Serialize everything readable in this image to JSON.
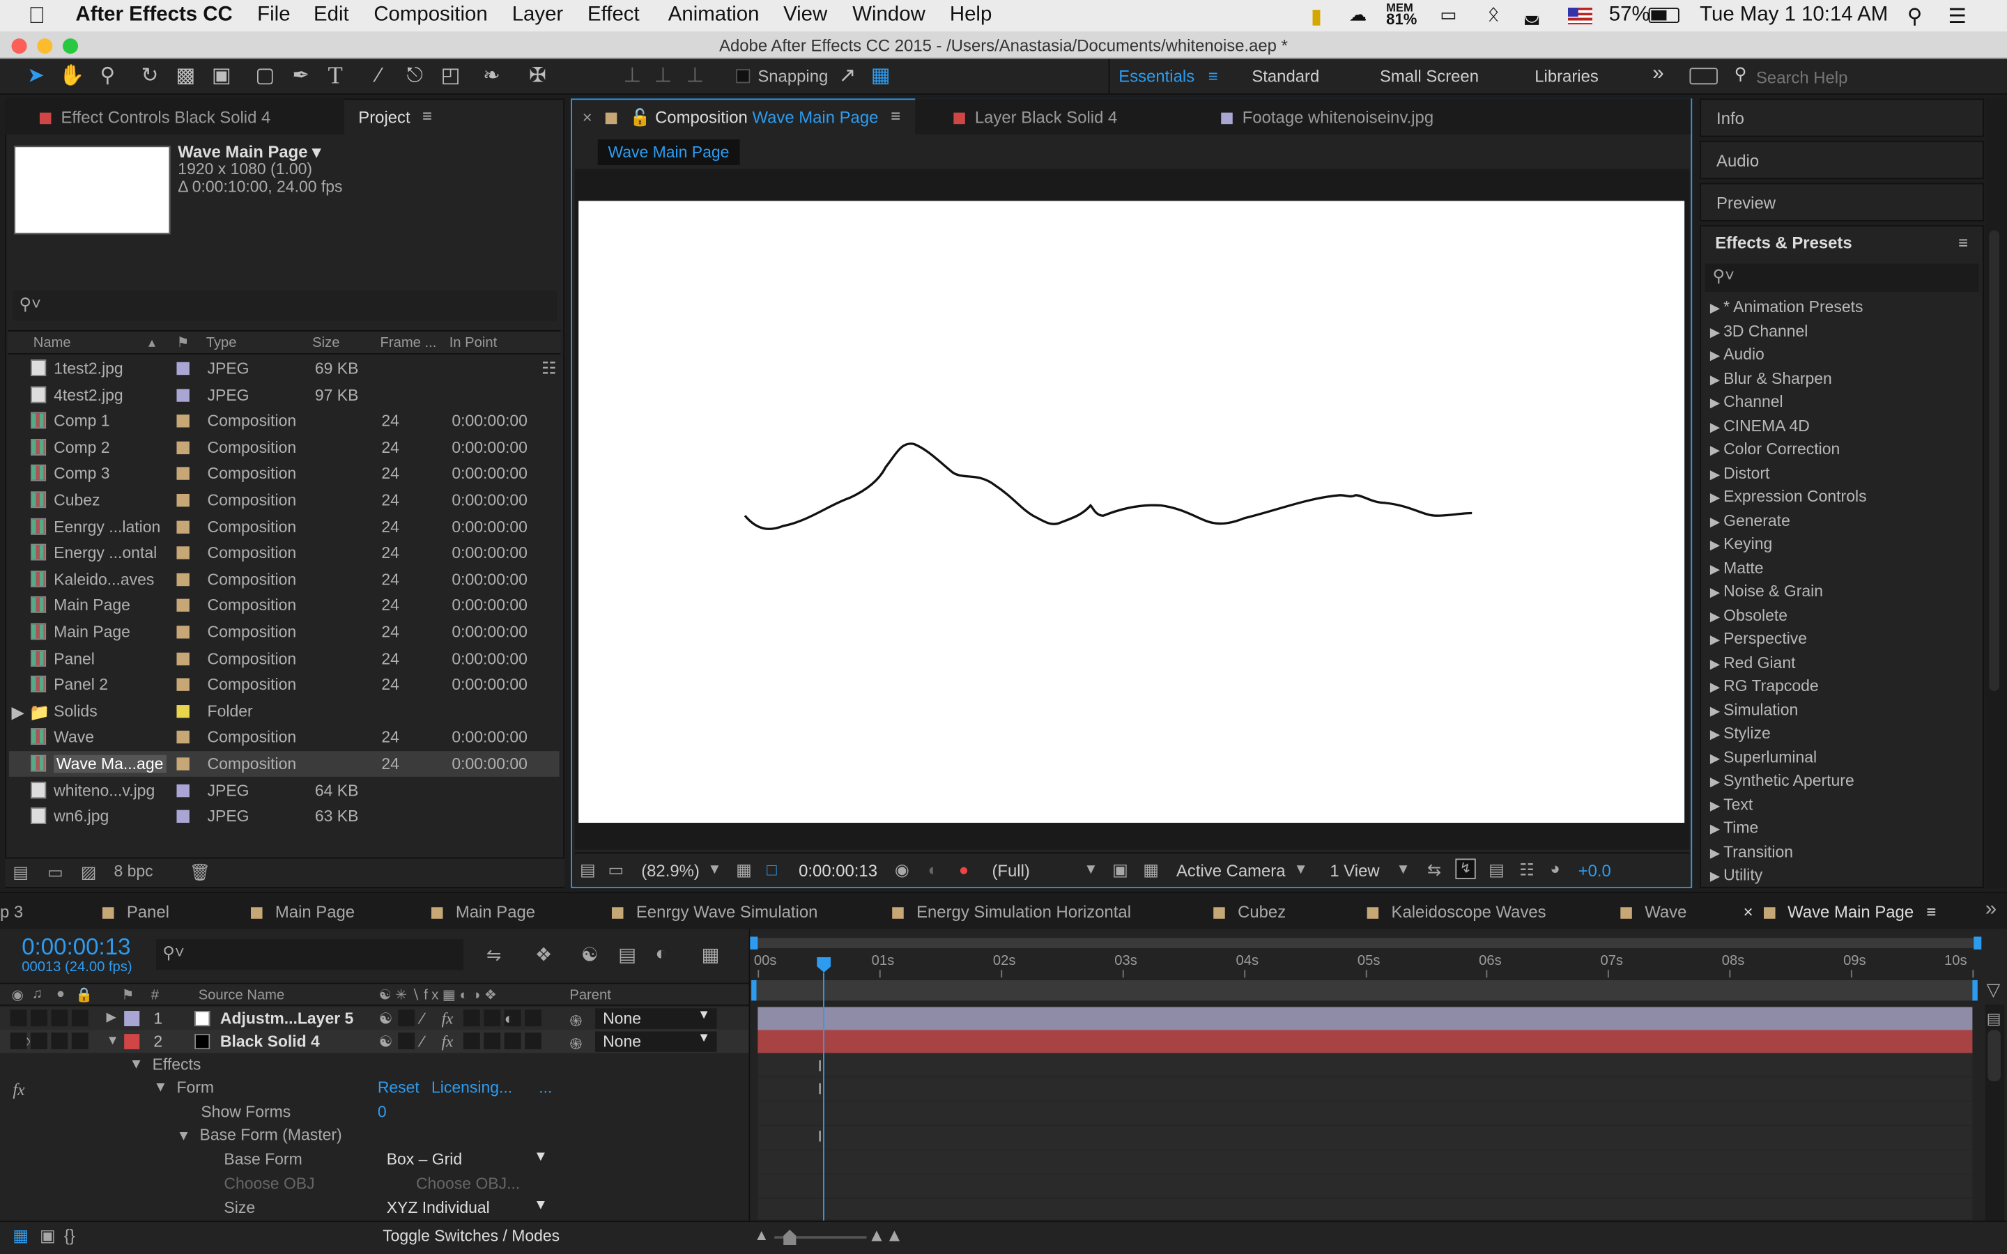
{
  "menubar": {
    "app": "After Effects CC",
    "items": [
      "File",
      "Edit",
      "Composition",
      "Layer",
      "Effect",
      "Animation",
      "View",
      "Window",
      "Help"
    ],
    "mem_label": "MEM",
    "mem_value": "81%",
    "battery": "57%",
    "datetime": "Tue May 1  10:14 AM"
  },
  "window_title": "Adobe After Effects CC 2015 - /Users/Anastasia/Documents/whitenoise.aep *",
  "toolbar": {
    "snapping": "Snapping",
    "workspaces": [
      "Essentials",
      "Standard",
      "Small Screen",
      "Libraries"
    ],
    "search_placeholder": "Search Help"
  },
  "left_panel": {
    "tab_effect_controls": "Effect Controls Black Solid 4",
    "tab_project": "Project",
    "comp_name": "Wave Main Page ▾",
    "comp_res": "1920 x 1080 (1.00)",
    "comp_dur": "Δ 0:00:10:00, 24.00 fps",
    "columns": [
      "Name",
      "Type",
      "Size",
      "Frame ...",
      "In Point"
    ],
    "bpc": "8 bpc",
    "items": [
      {
        "name": "1test2.jpg",
        "type": "JPEG",
        "size": "69 KB",
        "frame": "",
        "inpoint": "",
        "color": "#a9a6d4",
        "kind": "file"
      },
      {
        "name": "4test2.jpg",
        "type": "JPEG",
        "size": "97 KB",
        "frame": "",
        "inpoint": "",
        "color": "#a9a6d4",
        "kind": "file"
      },
      {
        "name": "Comp 1",
        "type": "Composition",
        "size": "",
        "frame": "24",
        "inpoint": "0:00:00:00",
        "color": "#c8a777",
        "kind": "comp"
      },
      {
        "name": "Comp 2",
        "type": "Composition",
        "size": "",
        "frame": "24",
        "inpoint": "0:00:00:00",
        "color": "#c8a777",
        "kind": "comp"
      },
      {
        "name": "Comp 3",
        "type": "Composition",
        "size": "",
        "frame": "24",
        "inpoint": "0:00:00:00",
        "color": "#c8a777",
        "kind": "comp"
      },
      {
        "name": "Cubez",
        "type": "Composition",
        "size": "",
        "frame": "24",
        "inpoint": "0:00:00:00",
        "color": "#c8a777",
        "kind": "comp"
      },
      {
        "name": "Eenrgy ...lation",
        "type": "Composition",
        "size": "",
        "frame": "24",
        "inpoint": "0:00:00:00",
        "color": "#c8a777",
        "kind": "comp"
      },
      {
        "name": "Energy ...ontal",
        "type": "Composition",
        "size": "",
        "frame": "24",
        "inpoint": "0:00:00:00",
        "color": "#c8a777",
        "kind": "comp"
      },
      {
        "name": "Kaleido...aves",
        "type": "Composition",
        "size": "",
        "frame": "24",
        "inpoint": "0:00:00:00",
        "color": "#c8a777",
        "kind": "comp"
      },
      {
        "name": "Main Page",
        "type": "Composition",
        "size": "",
        "frame": "24",
        "inpoint": "0:00:00:00",
        "color": "#c8a777",
        "kind": "comp"
      },
      {
        "name": "Main Page",
        "type": "Composition",
        "size": "",
        "frame": "24",
        "inpoint": "0:00:00:00",
        "color": "#c8a777",
        "kind": "comp"
      },
      {
        "name": "Panel",
        "type": "Composition",
        "size": "",
        "frame": "24",
        "inpoint": "0:00:00:00",
        "color": "#c8a777",
        "kind": "comp"
      },
      {
        "name": "Panel 2",
        "type": "Composition",
        "size": "",
        "frame": "24",
        "inpoint": "0:00:00:00",
        "color": "#c8a777",
        "kind": "comp"
      },
      {
        "name": "Solids",
        "type": "Folder",
        "size": "",
        "frame": "",
        "inpoint": "",
        "color": "#e8d44d",
        "kind": "folder"
      },
      {
        "name": "Wave",
        "type": "Composition",
        "size": "",
        "frame": "24",
        "inpoint": "0:00:00:00",
        "color": "#c8a777",
        "kind": "comp"
      },
      {
        "name": "Wave Ma...age",
        "type": "Composition",
        "size": "",
        "frame": "24",
        "inpoint": "0:00:00:00",
        "color": "#c8a777",
        "kind": "comp",
        "selected": true
      },
      {
        "name": "whiteno...v.jpg",
        "type": "JPEG",
        "size": "64 KB",
        "frame": "",
        "inpoint": "",
        "color": "#a9a6d4",
        "kind": "file"
      },
      {
        "name": "wn6.jpg",
        "type": "JPEG",
        "size": "63 KB",
        "frame": "",
        "inpoint": "",
        "color": "#a9a6d4",
        "kind": "file"
      }
    ]
  },
  "comp_panel": {
    "tab_comp_prefix": "Composition",
    "tab_comp_name": "Wave Main Page",
    "tab_layer": "Layer Black Solid 4",
    "tab_footage": "Footage whitenoiseinv.jpg",
    "breadcrumb": "Wave Main Page",
    "zoom": "(82.9%)",
    "timecode": "0:00:00:13",
    "resolution": "(Full)",
    "camera": "Active Camera",
    "views": "1 View",
    "exposure": "+0.0"
  },
  "right_panel": {
    "info": "Info",
    "audio": "Audio",
    "preview": "Preview",
    "effects_title": "Effects & Presets",
    "effects": [
      "* Animation Presets",
      "3D Channel",
      "Audio",
      "Blur & Sharpen",
      "Channel",
      "CINEMA 4D",
      "Color Correction",
      "Distort",
      "Expression Controls",
      "Generate",
      "Keying",
      "Matte",
      "Noise & Grain",
      "Obsolete",
      "Perspective",
      "Red Giant",
      "RG Trapcode",
      "Simulation",
      "Stylize",
      "Superluminal",
      "Synthetic Aperture",
      "Text",
      "Time",
      "Transition",
      "Utility"
    ]
  },
  "timeline": {
    "tabs": [
      "p 3",
      "Panel",
      "Main Page",
      "Main Page",
      "Eenrgy Wave Simulation",
      "Energy Simulation Horizontal",
      "Cubez",
      "Kaleidoscope Waves",
      "Wave",
      "Wave Main Page"
    ],
    "timecode": "0:00:00:13",
    "frames": "00013 (24.00 fps)",
    "col_hash": "#",
    "col_source": "Source Name",
    "col_parent": "Parent",
    "ruler": [
      "00s",
      "01s",
      "02s",
      "03s",
      "04s",
      "05s",
      "06s",
      "07s",
      "08s",
      "09s",
      "10s"
    ],
    "layers": [
      {
        "num": "1",
        "name": "Adjustm...Layer 5",
        "parent": "None",
        "color": "#a9a6d4"
      },
      {
        "num": "2",
        "name": "Black Solid 4",
        "parent": "None",
        "color": "#d04545"
      }
    ],
    "props": {
      "effects": "Effects",
      "form": "Form",
      "reset": "Reset",
      "licensing": "Licensing...",
      "ellipsis": "...",
      "show_forms": "Show Forms",
      "show_forms_value": "0",
      "base_form_master": "Base Form (Master)",
      "base_form": "Base Form",
      "base_form_value": "Box – Grid",
      "choose_obj": "Choose OBJ",
      "choose_obj_value": "Choose OBJ...",
      "size": "Size",
      "size_value": "XYZ Individual"
    },
    "toggle": "Toggle Switches / Modes",
    "cti_fraction": 0.054
  },
  "colors": {
    "accent": "#2d9cf0",
    "panel": "#232323",
    "layer_adjust": "#8f8ca7",
    "layer_solid": "#a84343"
  }
}
